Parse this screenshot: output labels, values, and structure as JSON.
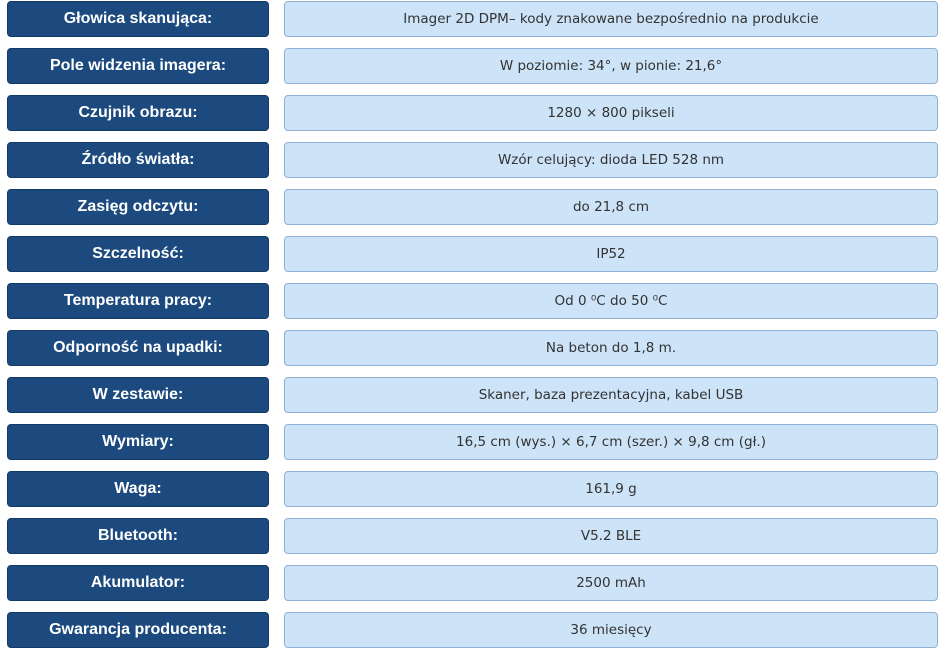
{
  "specs": [
    {
      "label": "Głowica skanująca:",
      "value": "Imager 2D DPM– kody znakowane bezpośrednio na produkcie"
    },
    {
      "label": "Pole widzenia imagera:",
      "value": "W poziomie: 34°, w pionie: 21,6°"
    },
    {
      "label": "Czujnik obrazu:",
      "value": "1280 × 800 pikseli"
    },
    {
      "label": "Źródło światła:",
      "value": "Wzór celujący: dioda LED 528 nm"
    },
    {
      "label": "Zasięg odczytu:",
      "value": "do 21,8 cm"
    },
    {
      "label": "Szczelność:",
      "value": "IP52"
    },
    {
      "label": "Temperatura pracy:",
      "value": "Od 0 ⁰C do 50 ⁰C"
    },
    {
      "label": "Odporność na upadki:",
      "value": "Na beton do 1,8 m."
    },
    {
      "label": "W zestawie:",
      "value": "Skaner, baza prezentacyjna, kabel USB"
    },
    {
      "label": "Wymiary:",
      "value": "16,5 cm (wys.) × 6,7 cm (szer.) × 9,8 cm (gł.)"
    },
    {
      "label": "Waga:",
      "value": "161,9 g"
    },
    {
      "label": "Bluetooth:",
      "value": "V5.2 BLE"
    },
    {
      "label": "Akumulator:",
      "value": "2500 mAh"
    },
    {
      "label": "Gwarancja producenta:",
      "value": "36 miesięcy"
    }
  ]
}
